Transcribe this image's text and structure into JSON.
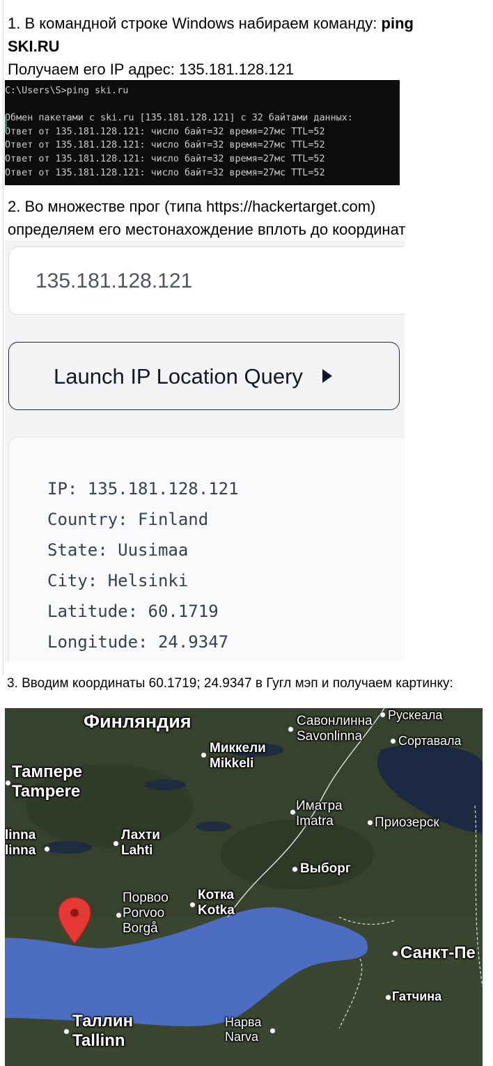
{
  "step1": {
    "line1_prefix": "1. В командной строке Windows набираем  команду: ",
    "line1_bold": "ping",
    "line2_bold": "SKI.RU",
    "line3": "Получаем его IP адрес: 135.181.128.121"
  },
  "console": {
    "lines": [
      "C:\\Users\\S>ping ski.ru",
      "",
      "Обмен пакетами с ski.ru [135.181.128.121] с 32 байтами данных:",
      "Ответ от 135.181.128.121: число байт=32 время=27мс TTL=52",
      "Ответ от 135.181.128.121: число байт=32 время=27мс TTL=52",
      "Ответ от 135.181.128.121: число байт=32 время=27мс TTL=52",
      "Ответ от 135.181.128.121: число байт=32 время=27мс TTL=52"
    ]
  },
  "step2": {
    "line1": "2. Во множестве прог (типа https://hackertarget.com)",
    "line2": "определяем его местонахождение вплоть до координат"
  },
  "lookup": {
    "ip_value": "135.181.128.121",
    "button_label": "Launch IP Location Query",
    "results": [
      "IP: 135.181.128.121",
      "Country: Finland",
      "State: Uusimaa",
      "City: Helsinki",
      "Latitude: 60.1719",
      "Longitude: 24.9347"
    ]
  },
  "step3": {
    "text": "3. Вводим координаты 60.1719; 24.9347 в Гугл мэп и получаем картинку:"
  },
  "map": {
    "colors": {
      "sea": "#4f6fc4",
      "land": "#3a4630",
      "lake": "#1d2a45"
    },
    "labels": {
      "finland": "Финляндия",
      "savonlinna_ru": "Савонлинна",
      "savonlinna_en": "Savonlinna",
      "ruskeala": "Рускеала",
      "sortavala": "Сортавала",
      "mikkeli_ru": "Миккели",
      "mikkeli_en": "Mikkeli",
      "tampere_ru": "Тампере",
      "tampere_en": "Tampere",
      "imatra_ru": "Иматра",
      "imatra_en": "Imatra",
      "priozersk": "Приозерск",
      "hameenlinna_ru": "linna",
      "hameenlinna_en": "linna",
      "lahti_ru": "Лахти",
      "lahti_en": "Lahti",
      "vyborg": "Выборг",
      "porvoo_ru": "Порвоо",
      "porvoo_en": "Porvoo",
      "porvoo_sv": "Borgå",
      "kotka_ru": "Котка",
      "kotka_en": "Kotka",
      "spb": "Санкт-Пе",
      "gatchina": "Гатчина",
      "tallinn_ru": "Таллин",
      "tallinn_en": "Tallinn",
      "narva_ru": "Нарва",
      "narva_en": "Narva"
    }
  }
}
